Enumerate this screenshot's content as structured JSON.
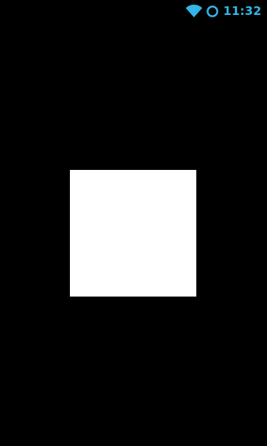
{
  "status_bar": {
    "time": "11:32",
    "icons": [
      "wifi-icon",
      "sync-icon"
    ],
    "accent_color": "#33b5e5"
  },
  "canvas": {
    "background_color": "#000000",
    "shape": "square",
    "shape_color": "#ffffff"
  }
}
